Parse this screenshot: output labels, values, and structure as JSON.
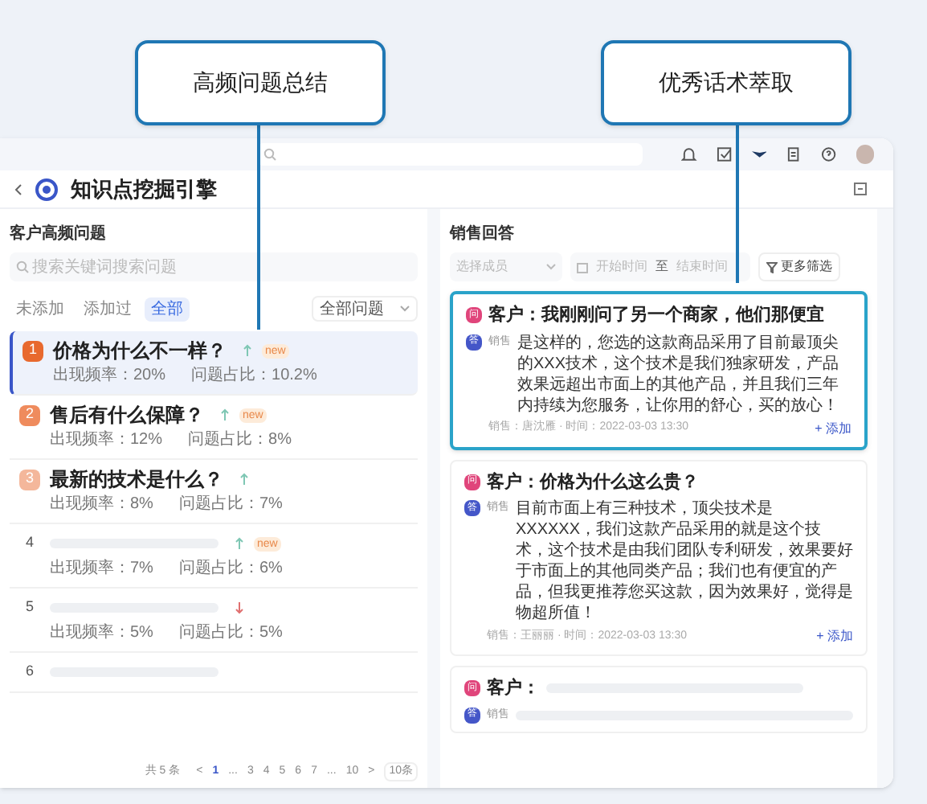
{
  "callouts": [
    {
      "label": "高频问题总结"
    },
    {
      "label": "优秀话术萃取"
    }
  ],
  "app": {
    "title": "知识点挖掘引擎"
  },
  "left_panel": {
    "title": "客户高频问题",
    "search": {
      "placeholder": "搜索关键词搜索问题"
    },
    "filters": [
      {
        "label": "未添加",
        "selected": false
      },
      {
        "label": "添加过",
        "selected": false
      },
      {
        "label": "全部",
        "selected": true
      }
    ],
    "dropdown": {
      "value": "全部问题"
    },
    "rows": [
      {
        "rank": "1",
        "color": "#e8692e",
        "title": "价格为什么不一样？",
        "rising": true,
        "new_label": "new",
        "frequency": "出现频率：20%",
        "share": "问题占比：10.2%",
        "selected": true
      },
      {
        "rank": "2",
        "color": "#ef8b5d",
        "title": "售后有什么保障？",
        "rising": true,
        "new_label": "new",
        "frequency": "出现频率：12%",
        "share": "问题占比：8%",
        "selected": false
      },
      {
        "rank": "3",
        "color": "#f4b79b",
        "title": "最新的技术是什么？",
        "rising": true,
        "frequency": "出现频率：8%",
        "share": "问题占比：7%",
        "selected": false
      },
      {
        "rank": "4",
        "rising": true,
        "new_label": "new",
        "frequency": "出现频率：7%",
        "share": "问题占比：6%",
        "selected": false
      },
      {
        "rank": "5",
        "rising": false,
        "frequency": "出现频率：5%",
        "share": "问题占比：5%",
        "selected": false
      },
      {
        "rank": "6",
        "selected": false
      }
    ],
    "pagination": {
      "total": "共 5 条",
      "pages": [
        {
          "label": "<",
          "selected": false
        },
        {
          "label": "1",
          "selected": true
        },
        {
          "label": "...",
          "selected": false
        },
        {
          "label": "3",
          "selected": false
        },
        {
          "label": "4",
          "selected": false
        },
        {
          "label": "5",
          "selected": false
        },
        {
          "label": "6",
          "selected": false
        },
        {
          "label": "7",
          "selected": false
        },
        {
          "label": "...",
          "selected": false
        },
        {
          "label": "10",
          "selected": false
        },
        {
          "label": ">",
          "selected": false
        }
      ],
      "page_size": "10条"
    }
  },
  "right_panel": {
    "title": "销售回答",
    "member_select": {
      "placeholder": "选择成员"
    },
    "date_range": {
      "start": "开始时间",
      "separator": "至",
      "end": "结束时间"
    },
    "more_filters": "更多筛选",
    "cards": [
      {
        "selected": true,
        "q_badge": "问",
        "question": "客户：我刚刚问了另一个商家，他们那便宜",
        "a_badge": "答",
        "speaker": "销售",
        "answer": "是这样的，您选的这款商品采用了目前最顶尖的XXX技术，这个技术是我们独家研发，产品效果远超出市面上的其他产品，并且我们三年内持续为您服务，让你用的舒心，买的放心！",
        "meta": "销售：唐沈雁 · 时间：2022-03-03 13:30",
        "add": "+ 添加"
      },
      {
        "selected": false,
        "q_badge": "问",
        "question": "客户：价格为什么这么贵？",
        "a_badge": "答",
        "speaker": "销售",
        "answer": "目前市面上有三种技术，顶尖技术是XXXXXX，我们这款产品采用的就是这个技术，这个技术是由我们团队专利研发，效果要好于市面上的其他同类产品；我们也有便宜的产品，但我更推荐您买这款，因为效果好，觉得是物超所值！",
        "meta": "销售：王丽丽 · 时间：2022-03-03 13:30",
        "add": "+ 添加"
      },
      {
        "selected": false,
        "q_badge": "问",
        "question": "客户：",
        "a_badge": "答",
        "speaker": "销售"
      }
    ]
  }
}
